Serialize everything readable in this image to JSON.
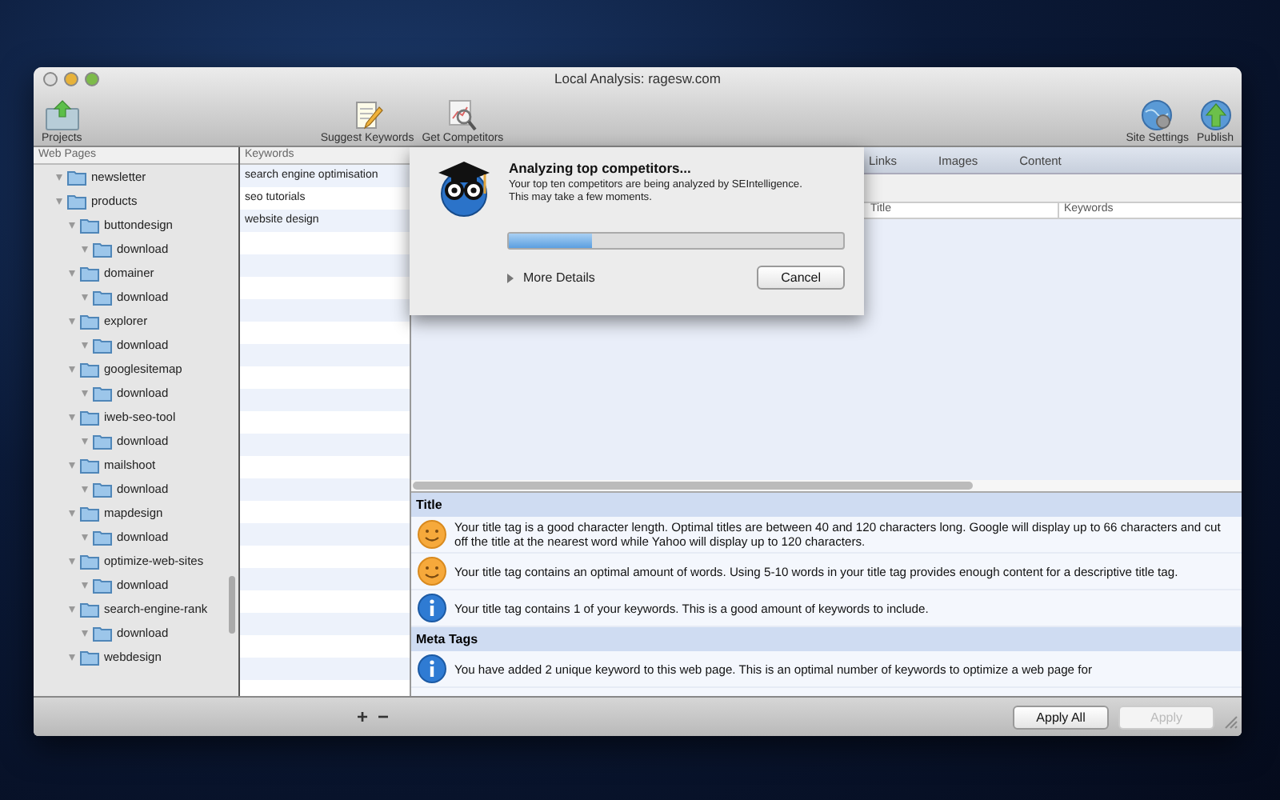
{
  "window": {
    "title": "Local Analysis: ragesw.com"
  },
  "toolbar": {
    "left": [
      {
        "kind": "projects",
        "label": "Projects"
      }
    ],
    "center": [
      {
        "kind": "suggest",
        "label": "Suggest Keywords"
      },
      {
        "kind": "competitors",
        "label": "Get Competitors"
      }
    ],
    "right": [
      {
        "kind": "settings",
        "label": "Site Settings"
      },
      {
        "kind": "publish",
        "label": "Publish"
      }
    ]
  },
  "sidebar": {
    "header": "Web Pages",
    "items": [
      {
        "label": "newsletter",
        "expanded": true
      },
      {
        "label": "products",
        "expanded": true,
        "children": [
          {
            "label": "buttondesign",
            "expanded": true,
            "children": [
              {
                "label": "download",
                "expanded": true
              }
            ]
          },
          {
            "label": "domainer",
            "expanded": true,
            "children": [
              {
                "label": "download",
                "expanded": true
              }
            ]
          },
          {
            "label": "explorer",
            "expanded": true,
            "children": [
              {
                "label": "download",
                "expanded": true
              }
            ]
          },
          {
            "label": "googlesitemap",
            "expanded": true,
            "children": [
              {
                "label": "download",
                "expanded": true
              }
            ]
          },
          {
            "label": "iweb-seo-tool",
            "expanded": true,
            "children": [
              {
                "label": "download",
                "expanded": true
              }
            ]
          },
          {
            "label": "mailshoot",
            "expanded": true,
            "children": [
              {
                "label": "download",
                "expanded": true
              }
            ]
          },
          {
            "label": "mapdesign",
            "expanded": true,
            "children": [
              {
                "label": "download",
                "expanded": true
              }
            ]
          },
          {
            "label": "optimize-web-sites",
            "expanded": true,
            "children": [
              {
                "label": "download",
                "expanded": true
              }
            ]
          },
          {
            "label": "search-engine-rank",
            "expanded": true,
            "children": [
              {
                "label": "download",
                "expanded": true
              }
            ]
          },
          {
            "label": "webdesign",
            "expanded": true
          }
        ]
      }
    ]
  },
  "keywords": {
    "header": "Keywords",
    "items": [
      "search engine optimisation",
      "seo tutorials",
      "website design"
    ]
  },
  "tabs": [
    {
      "label": "Links",
      "selected": false
    },
    {
      "label": "Images",
      "selected": false
    },
    {
      "label": "Content",
      "selected": false
    }
  ],
  "table": {
    "columns": [
      "Title",
      "Keywords"
    ]
  },
  "analysis": [
    {
      "title": "Title",
      "items": [
        {
          "kind": "smiley",
          "text": "Your title tag is a good character length. Optimal titles are between 40 and 120 characters long. Google will display up to 66 characters and cut off the title at the nearest word while Yahoo will display up to 120 characters."
        },
        {
          "kind": "smiley",
          "text": "Your title tag contains an optimal amount of words. Using 5-10 words in your title tag provides enough content for a descriptive title tag."
        },
        {
          "kind": "info",
          "text": "Your title tag contains 1 of your keywords. This is a good amount of keywords to include."
        }
      ]
    },
    {
      "title": "Meta Tags",
      "items": [
        {
          "kind": "info",
          "text": "You have added 2 unique keyword to this web page. This is an optimal number of keywords to optimize a web page for"
        }
      ]
    }
  ],
  "dialog": {
    "title": "Analyzing top competitors...",
    "message": [
      "Your top ten competitors are being analyzed by SEIntelligence.",
      "This may take a few moments."
    ],
    "progress": {
      "level": 0.25
    },
    "details": {
      "label": "More Details",
      "expanded": false
    },
    "button": "Cancel"
  },
  "bottom_bar": {
    "add": "+",
    "remove": "−",
    "buttons": [
      {
        "label": "Apply All",
        "disabled": false
      },
      {
        "label": "Apply",
        "disabled": true
      }
    ]
  }
}
